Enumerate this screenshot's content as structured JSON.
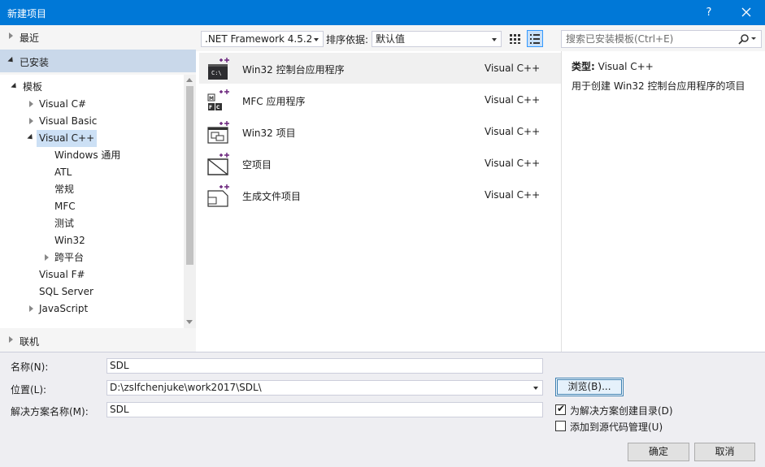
{
  "window": {
    "title": "新建项目",
    "help": "?"
  },
  "left_panel": {
    "recent": "最近",
    "installed": "已安装",
    "online": "联机",
    "tree": {
      "templates": "模板",
      "visual_csharp": "Visual C#",
      "visual_basic": "Visual Basic",
      "visual_cpp": "Visual C++",
      "windows_general": "Windows 通用",
      "atl": "ATL",
      "general": "常规",
      "mfc": "MFC",
      "test": "测试",
      "win32": "Win32",
      "cross_platform": "跨平台",
      "visual_fsharp": "Visual F#",
      "sql_server": "SQL Server",
      "javascript": "JavaScript"
    }
  },
  "toolbar": {
    "framework": ".NET Framework 4.5.2",
    "sort_label": "排序依据:",
    "sort_value": "默认值",
    "search_placeholder": "搜索已安装模板(Ctrl+E)"
  },
  "templates": [
    {
      "name": "Win32 控制台应用程序",
      "lang": "Visual C++"
    },
    {
      "name": "MFC 应用程序",
      "lang": "Visual C++"
    },
    {
      "name": "Win32 项目",
      "lang": "Visual C++"
    },
    {
      "name": "空项目",
      "lang": "Visual C++"
    },
    {
      "name": "生成文件项目",
      "lang": "Visual C++"
    }
  ],
  "description": {
    "type_label": "类型:",
    "type_value": "Visual C++",
    "text": "用于创建 Win32 控制台应用程序的项目"
  },
  "form": {
    "name_label": "名称(N):",
    "name_value": "SDL",
    "location_label": "位置(L):",
    "location_value": "D:\\zslfchenjuke\\work2017\\SDL\\",
    "solution_label": "解决方案名称(M):",
    "solution_value": "SDL",
    "browse": "浏览(B)...",
    "create_dir": "为解决方案创建目录(D)",
    "add_source_control": "添加到源代码管理(U)",
    "ok": "确定",
    "cancel": "取消"
  },
  "colors": {
    "titlebar": "#0078d7",
    "accent": "#68217a",
    "selection": "#cce0f5"
  }
}
